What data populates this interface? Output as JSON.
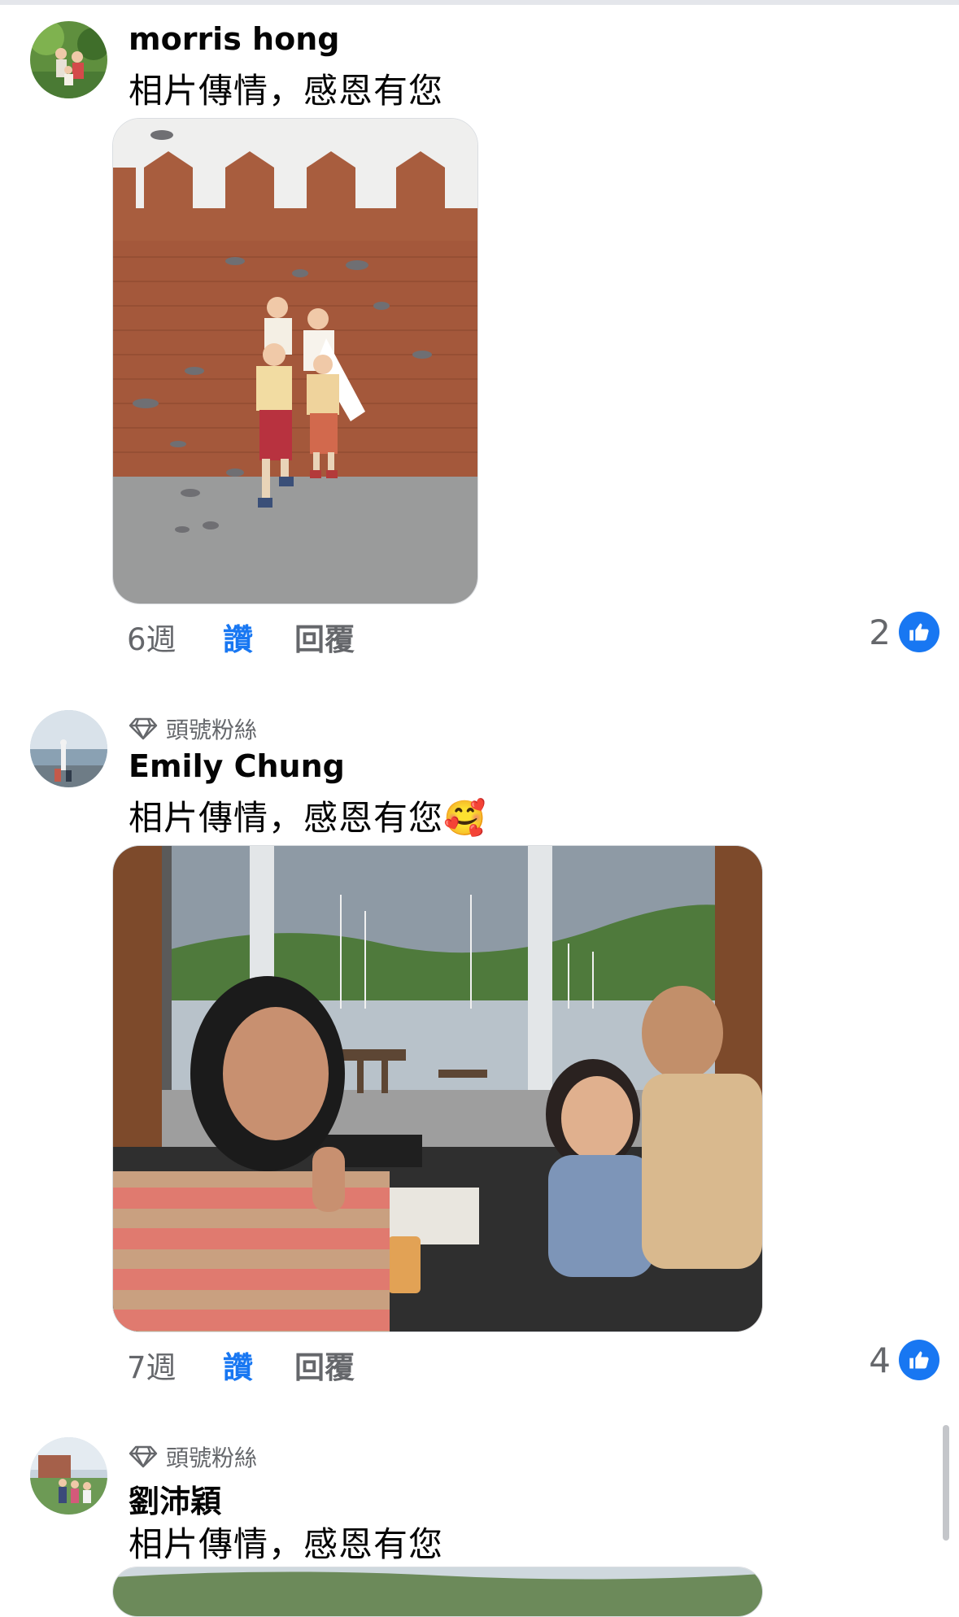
{
  "comments": [
    {
      "author": "morris hong",
      "text": "相片傳情，感恩有您",
      "time": "6週",
      "like_label": "讚",
      "reply_label": "回覆",
      "reaction_count": "2",
      "reaction_icon": "thumbs-up-icon"
    },
    {
      "badge": "頭號粉絲",
      "badge_icon": "diamond-icon",
      "author": "Emily Chung",
      "text": "相片傳情，感恩有您🥰",
      "time": "7週",
      "like_label": "讚",
      "reply_label": "回覆",
      "reaction_count": "4",
      "reaction_icon": "thumbs-up-icon"
    },
    {
      "badge": "頭號粉絲",
      "badge_icon": "diamond-icon",
      "author": "劉沛穎",
      "text": "相片傳情，感恩有您"
    }
  ],
  "colors": {
    "accent": "#1877f2",
    "secondary_text": "#65676b",
    "primary_text": "#050505"
  }
}
